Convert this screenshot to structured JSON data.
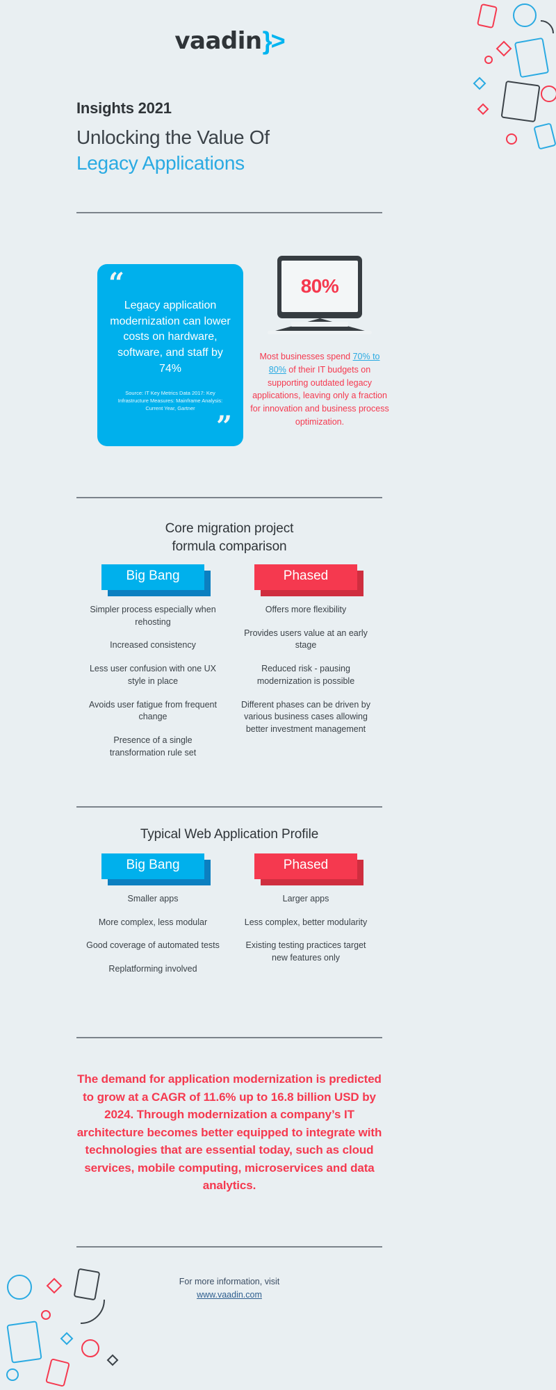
{
  "brand": {
    "logo_word": "vaadin",
    "logo_mark": "}>",
    "accent_blue": "#00b0ec",
    "accent_red": "#f5394f",
    "link_blue": "#2aaae2",
    "background": "#e9eff2"
  },
  "header": {
    "kicker": "Insights 2021",
    "headline_line1": "Unlocking the Value Of",
    "headline_line2": "Legacy Applications"
  },
  "quote_card": {
    "open_quote": "“",
    "close_quote": "”",
    "text": "Legacy application modernization can lower costs on hardware, software, and staff by 74%",
    "source": "Source: IT Key Metrics Data 2017: Key Infrastructure Measures: Mainframe Analysis: Current Year, Gartner"
  },
  "stat": {
    "screen_value": "80%",
    "note_before": "Most businesses spend ",
    "note_link": "70% to 80%",
    "note_after": " of their IT budgets on supporting outdated legacy applications, leaving only a fraction for innovation and business process optimization."
  },
  "section_core": {
    "title_line1": "Core migration project",
    "title_line2": "formula comparison",
    "columns": [
      {
        "badge": "Big Bang",
        "items": [
          "Simpler process especially when rehosting",
          "Increased consistency",
          "Less user confusion with one UX style in place",
          "Avoids user fatigue from frequent change",
          "Presence of a single transformation rule set"
        ]
      },
      {
        "badge": "Phased",
        "items": [
          "Offers more flexibility",
          "Provides users value at an early stage",
          "Reduced risk - pausing modernization is possible",
          "Different phases can be driven by various business cases allowing better investment management"
        ]
      }
    ]
  },
  "section_profile": {
    "title": "Typical Web Application Profile",
    "columns": [
      {
        "badge": "Big Bang",
        "items": [
          "Smaller apps",
          "More complex, less modular",
          "Good coverage of automated tests",
          "Replatforming involved"
        ]
      },
      {
        "badge": "Phased",
        "items": [
          "Larger apps",
          "Less complex, better modularity",
          "Existing testing practices target new features only"
        ]
      }
    ]
  },
  "closing": {
    "text": "The demand for application modernization is predicted to grow at a CAGR of 11.6% up to 16.8 billion USD by 2024. Through modernization a company’s IT architecture becomes better equipped to integrate with technologies that are essential today, such as cloud services, mobile computing, microservices and data analytics."
  },
  "footer": {
    "line1": "For more information, visit",
    "link": "www.vaadin.com"
  }
}
